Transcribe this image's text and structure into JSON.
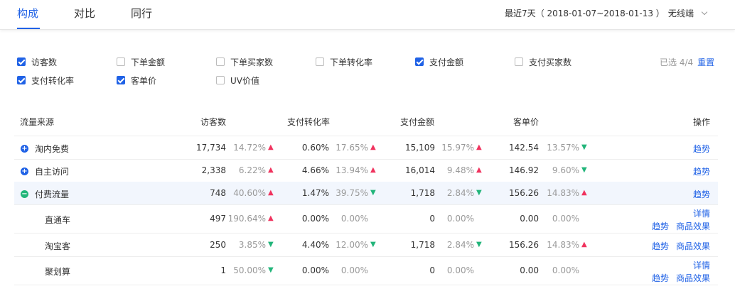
{
  "tabs": [
    "构成",
    "对比",
    "同行"
  ],
  "range_label": "最近7天（ 2018-01-07~2018-01-13 ）",
  "device_label": "无线端",
  "metrics": [
    {
      "label": "访客数",
      "checked": true
    },
    {
      "label": "下单金额",
      "checked": false
    },
    {
      "label": "下单买家数",
      "checked": false
    },
    {
      "label": "下单转化率",
      "checked": false
    },
    {
      "label": "支付金额",
      "checked": true
    },
    {
      "label": "支付买家数",
      "checked": false
    },
    {
      "label": "支付转化率",
      "checked": true
    },
    {
      "label": "客单价",
      "checked": true
    },
    {
      "label": "UV价值",
      "checked": false
    }
  ],
  "selected_info": "已选 4/4",
  "reset_label": "重置",
  "table": {
    "headers": [
      "流量来源",
      "访客数",
      "支付转化率",
      "支付金额",
      "客单价",
      "操作"
    ],
    "rows": [
      {
        "name": "淘内免费",
        "expand": "+",
        "visitors": "17,734",
        "visitors_pct": "14.72%",
        "visitors_dir": "up",
        "conv": "0.60%",
        "conv_pct": "17.65%",
        "conv_dir": "up",
        "amount": "15,109",
        "amount_pct": "15.97%",
        "amount_dir": "up",
        "price": "142.54",
        "price_pct": "13.57%",
        "price_dir": "down",
        "action1": "趋势"
      },
      {
        "name": "自主访问",
        "expand": "+",
        "visitors": "2,338",
        "visitors_pct": "6.22%",
        "visitors_dir": "up",
        "conv": "4.66%",
        "conv_pct": "13.94%",
        "conv_dir": "up",
        "amount": "16,014",
        "amount_pct": "9.48%",
        "amount_dir": "up",
        "price": "146.92",
        "price_pct": "9.60%",
        "price_dir": "down",
        "action1": "趋势"
      },
      {
        "name": "付费流量",
        "expand": "−",
        "visitors": "748",
        "visitors_pct": "40.60%",
        "visitors_dir": "up",
        "conv": "1.47%",
        "conv_pct": "39.75%",
        "conv_dir": "down",
        "amount": "1,718",
        "amount_pct": "2.84%",
        "amount_dir": "down",
        "price": "156.26",
        "price_pct": "14.83%",
        "price_dir": "up",
        "action1": "趋势"
      },
      {
        "name": "直通车",
        "visitors": "497",
        "visitors_pct": "190.64%",
        "visitors_dir": "up",
        "conv": "0.00%",
        "conv_pct": "0.00%",
        "amount": "0",
        "amount_pct": "0.00%",
        "price": "0.00",
        "price_pct": "0.00%",
        "action_top": "详情",
        "action1": "趋势",
        "action2": "商品效果"
      },
      {
        "name": "淘宝客",
        "visitors": "250",
        "visitors_pct": "3.85%",
        "visitors_dir": "down",
        "conv": "4.40%",
        "conv_pct": "12.00%",
        "conv_dir": "down",
        "amount": "1,718",
        "amount_pct": "2.84%",
        "amount_dir": "down",
        "price": "156.26",
        "price_pct": "14.83%",
        "price_dir": "up",
        "action1": "趋势",
        "action2": "商品效果"
      },
      {
        "name": "聚划算",
        "visitors": "1",
        "visitors_pct": "50.00%",
        "visitors_dir": "down",
        "conv": "0.00%",
        "conv_pct": "0.00%",
        "amount": "0",
        "amount_pct": "0.00%",
        "price": "0.00",
        "price_pct": "0.00%",
        "action_top": "详情",
        "action1": "趋势",
        "action2": "商品效果"
      }
    ]
  },
  "colors": {
    "accent": "#2062e6",
    "up": "#f0335e",
    "down": "#22b57a"
  }
}
